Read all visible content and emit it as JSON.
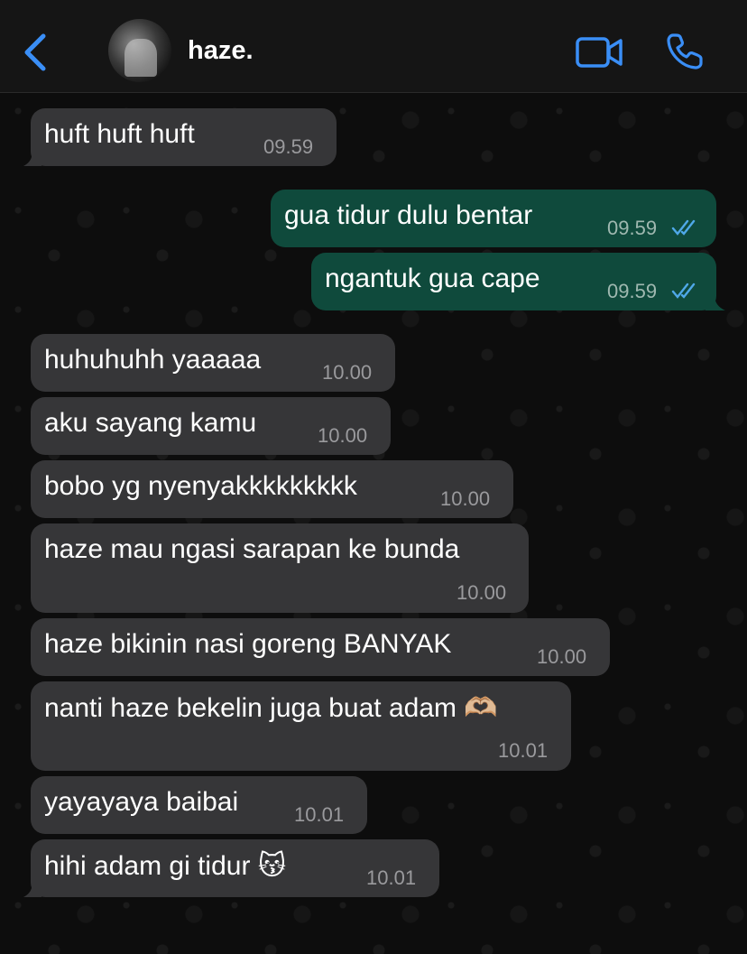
{
  "contact": {
    "name": "haze.",
    "avatar_icon": "contact-avatar"
  },
  "header_icons": {
    "back": "chevron-left-icon",
    "video": "video-call-icon",
    "phone": "phone-call-icon",
    "accent": "#3a8ef6"
  },
  "colors": {
    "incoming_bubble": "#363638",
    "outgoing_bubble": "#0f4a3c",
    "read_ticks": "#4fa8e8"
  },
  "messages": [
    {
      "dir": "in",
      "text": "huft huft huft",
      "time": "09.59"
    },
    {
      "dir": "out",
      "text": "gua tidur dulu bentar",
      "time": "09.59",
      "status": "read"
    },
    {
      "dir": "out",
      "text": "ngantuk gua cape",
      "time": "09.59",
      "status": "read"
    },
    {
      "dir": "in",
      "text": "huhuhuhh yaaaaa",
      "time": "10.00"
    },
    {
      "dir": "in",
      "text": "aku sayang kamu",
      "time": "10.00"
    },
    {
      "dir": "in",
      "text": "bobo yg nyenyakkkkkkkkk",
      "time": "10.00"
    },
    {
      "dir": "in",
      "text": "haze mau ngasi sarapan ke bunda",
      "time": "10.00"
    },
    {
      "dir": "in",
      "text": "haze bikinin nasi goreng BANYAK",
      "time": "10.00"
    },
    {
      "dir": "in",
      "text": "nanti haze bekelin juga buat adam 🫶🏼",
      "time": "10.01"
    },
    {
      "dir": "in",
      "text": "yayayaya baibai",
      "time": "10.01"
    },
    {
      "dir": "in",
      "text": "hihi adam gi tidur 😽",
      "time": "10.01"
    }
  ]
}
